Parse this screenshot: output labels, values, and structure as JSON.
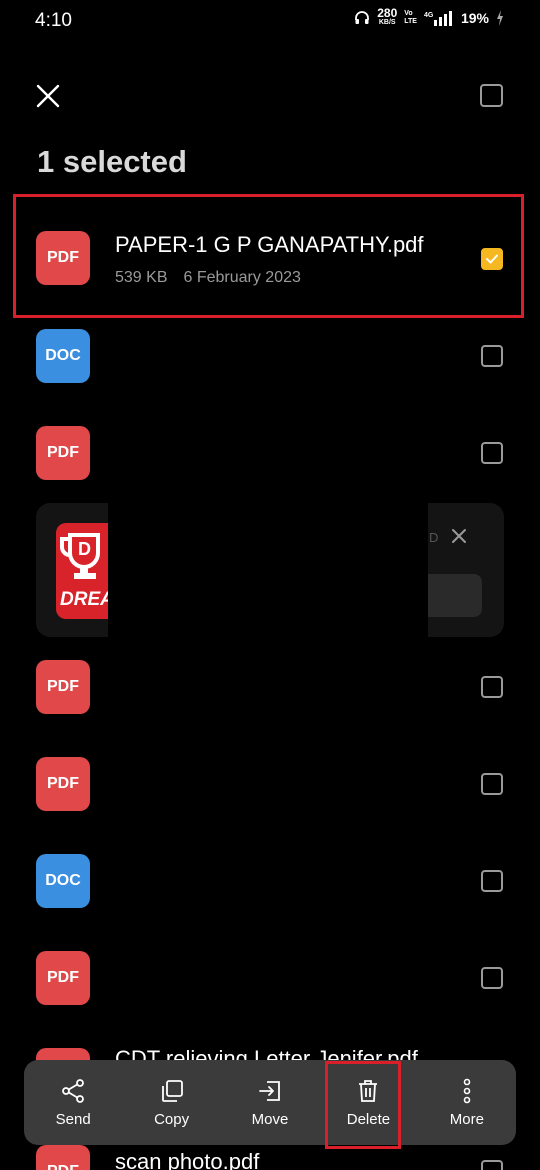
{
  "status_bar": {
    "time": "4:10",
    "net_speed": "280",
    "net_unit": "KB/S",
    "volte_top": "Vo",
    "volte_bottom": "LTE",
    "signal_tag": "4G",
    "battery": "19%"
  },
  "header": {
    "title": "1 selected"
  },
  "files": [
    {
      "type": "PDF",
      "name": "PAPER-1 G P GANAPATHY.pdf",
      "size": "539 KB",
      "date": "6 February 2023",
      "checked": true
    },
    {
      "type": "DOC",
      "checked": false
    },
    {
      "type": "PDF",
      "checked": false
    },
    {
      "type": "PDF",
      "checked": false
    },
    {
      "type": "PDF",
      "checked": false
    },
    {
      "type": "DOC",
      "checked": false
    },
    {
      "type": "PDF",
      "checked": false
    },
    {
      "type": "PDF",
      "name": "CDT relieving Letter Jenifer.pdf"
    },
    {
      "type": "PDF",
      "name": "scan photo.pdf"
    }
  ],
  "ad": {
    "logo_text": "DREA",
    "letter": "D"
  },
  "actions": [
    {
      "label": "Send",
      "icon": "share-icon"
    },
    {
      "label": "Copy",
      "icon": "copy-icon"
    },
    {
      "label": "Move",
      "icon": "move-icon"
    },
    {
      "label": "Delete",
      "icon": "trash-icon"
    },
    {
      "label": "More",
      "icon": "more-vertical-icon"
    }
  ],
  "colors": {
    "pdf": "#e0484a",
    "doc": "#3a8fe0",
    "check": "#f5b820",
    "highlight": "#d91f2a"
  }
}
